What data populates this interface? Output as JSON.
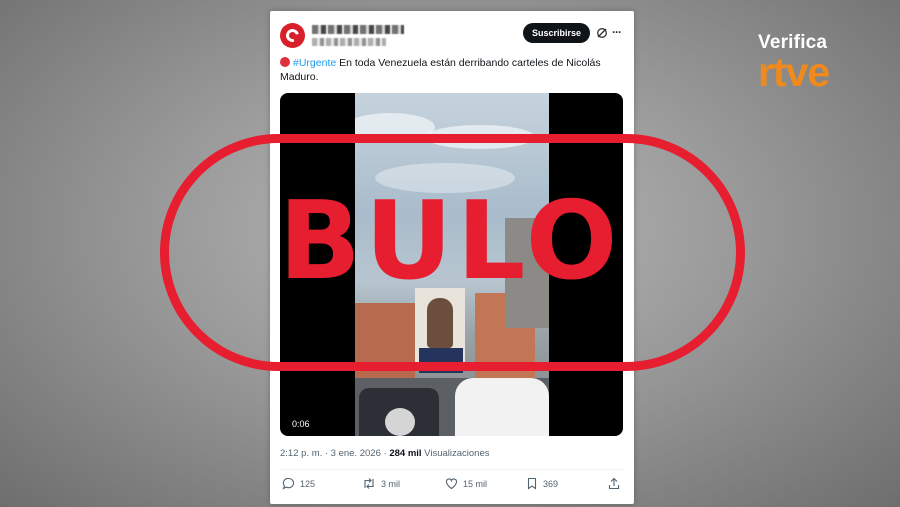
{
  "brand": {
    "line1": "Verifica",
    "line2": "rtve"
  },
  "tweet": {
    "subscribe_label": "Suscribirse",
    "more_label": "···",
    "hashtag": "#Urgente",
    "text": " En toda Venezuela están derribando carteles de Nicolás Maduro.",
    "video_time": "0:06",
    "time_date": "2:12 p. m. · 3 ene. 2026 · ",
    "views_count": "284 mil",
    "views_label": " Visualizaciones",
    "replies": "125",
    "reposts": "3 mil",
    "likes": "15 mil",
    "bookmarks": "369"
  },
  "stamp": {
    "label": "BULO"
  },
  "colors": {
    "stamp_red": "#e61e30",
    "rtve_orange": "#f08a1c",
    "link_blue": "#1d9bf0"
  }
}
